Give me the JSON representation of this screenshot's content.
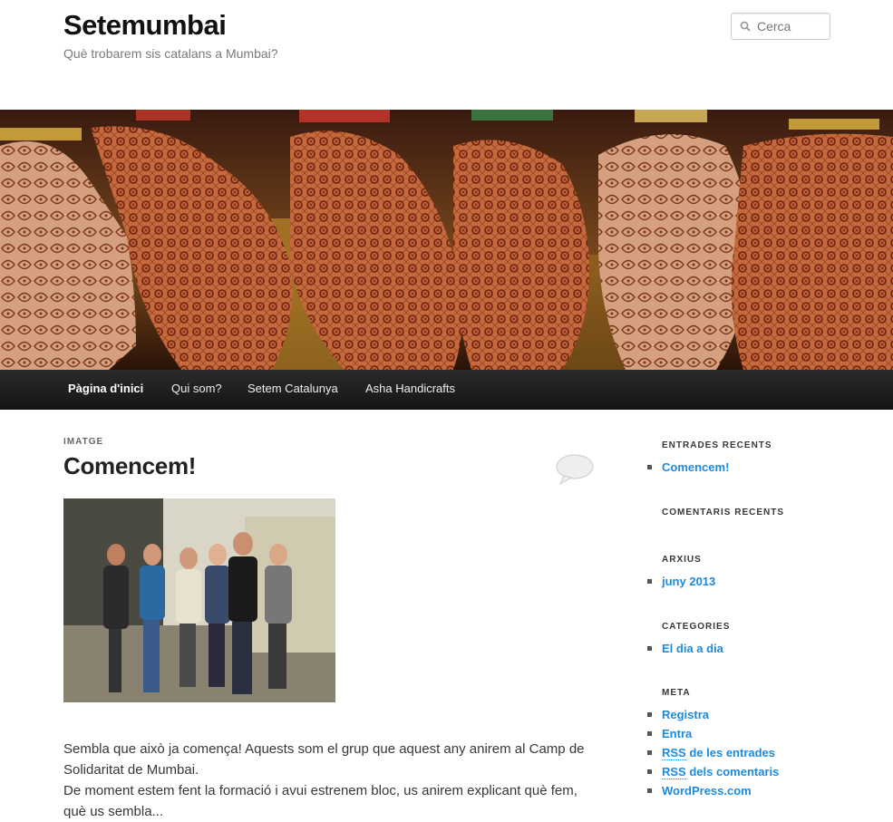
{
  "site": {
    "title": "Setemumbai",
    "description": "Què trobarem sis catalans a Mumbai?"
  },
  "search": {
    "placeholder": "Cerca"
  },
  "nav": {
    "items": [
      {
        "label": "Pàgina d'inici"
      },
      {
        "label": "Qui som?"
      },
      {
        "label": "Setem Catalunya"
      },
      {
        "label": "Asha Handicrafts"
      }
    ]
  },
  "post": {
    "format": "IMATGE",
    "title": "Comencem!",
    "paragraphs": [
      "Sembla que això ja comença! Aquests som el grup que aquest any anirem al Camp de Solidaritat de Mumbai.",
      "De moment estem fent la formació i avui estrenem bloc, us anirem explicant què fem, què us sembla..."
    ]
  },
  "sidebar": {
    "recent_posts": {
      "title": "ENTRADES RECENTS",
      "items": [
        "Comencem!"
      ]
    },
    "recent_comments": {
      "title": "COMENTARIS RECENTS"
    },
    "archives": {
      "title": "ARXIUS",
      "items": [
        "juny 2013"
      ]
    },
    "categories": {
      "title": "CATEGORIES",
      "items": [
        "El dia a dia"
      ]
    },
    "meta": {
      "title": "META",
      "items": [
        "Registra",
        "Entra",
        "RSS",
        "de les entrades",
        "RSS",
        "dels comentaris",
        "WordPress.com"
      ]
    }
  },
  "colors": {
    "link": "#1b8be0",
    "nav_bg": "#222222"
  }
}
